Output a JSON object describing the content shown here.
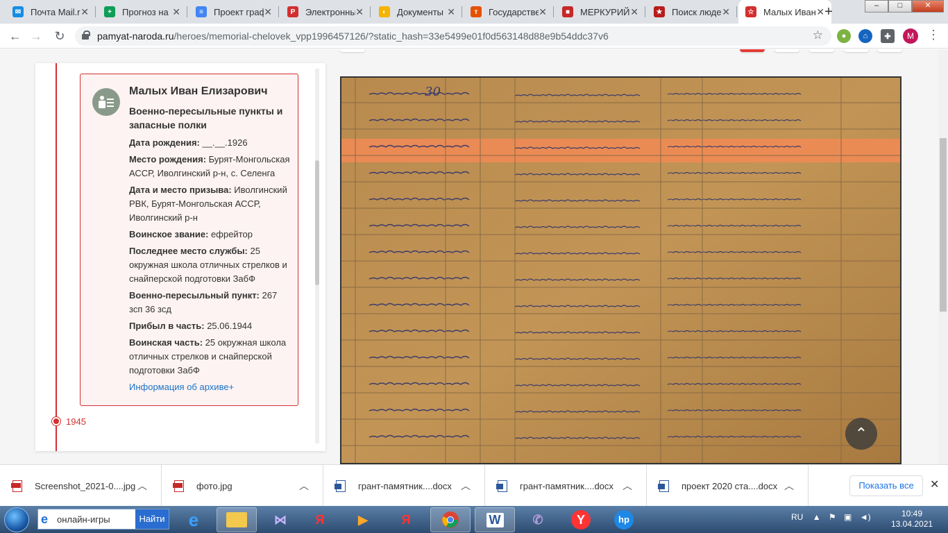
{
  "browser": {
    "tabs": [
      {
        "label": "Почта Mail.ru",
        "icon": "mail-icon",
        "color": "#168de2",
        "glyph": "✉"
      },
      {
        "label": "Прогноз на",
        "icon": "sheets-icon",
        "color": "#0f9d58",
        "glyph": "+"
      },
      {
        "label": "Проект граф",
        "icon": "docs-icon",
        "color": "#4285f4",
        "glyph": "≡"
      },
      {
        "label": "Электронны",
        "icon": "rdu-icon",
        "color": "#d32f2f",
        "glyph": "Р"
      },
      {
        "label": "Документы",
        "icon": "drive-icon",
        "color": "#f4b400",
        "glyph": "◐"
      },
      {
        "label": "Государстве",
        "icon": "gos-icon",
        "color": "#e65100",
        "glyph": "т"
      },
      {
        "label": "МЕРКУРИЙ",
        "icon": "mercury-icon",
        "color": "#c62828",
        "glyph": "■"
      },
      {
        "label": "Поиск люде",
        "icon": "search-people-icon",
        "color": "#b71c1c",
        "glyph": "★"
      },
      {
        "label": "Малых Иван",
        "icon": "memory-star-icon",
        "color": "#d32f2f",
        "glyph": "☆"
      }
    ],
    "new_tab": "+",
    "window_controls": {
      "minimize": "–",
      "maximize": "□",
      "close": "✕"
    },
    "url_host": "pamyat-naroda.ru",
    "url_path": "/heroes/memorial-chelovek_vpp1996457126/?static_hash=33e5499e01f0d563148d88e9b54ddc37v6",
    "avatar_letter": "M"
  },
  "record": {
    "name": "Малых Иван Елизарович",
    "category": "Военно-пересыльные пункты и запасные полки",
    "fields": [
      {
        "label": "Дата рождения:",
        "value": " __.__.1926"
      },
      {
        "label": "Место рождения:",
        "value": " Бурят-Монгольская АССР, Иволгинский р-н, с. Селенга"
      },
      {
        "label": "Дата и место призыва:",
        "value": " Иволгинский РВК, Бурят-Монгольская АССР, Иволгинский р-н"
      },
      {
        "label": "Воинское звание:",
        "value": " ефрейтор"
      },
      {
        "label": "Последнее место службы:",
        "value": " 25 окружная школа отличных стрелков и снайперской подготовки ЗабФ"
      },
      {
        "label": "Военно-пересыльный пункт:",
        "value": " 267 зсп 36 зсд"
      },
      {
        "label": "Прибыл в часть:",
        "value": " 25.06.1944"
      },
      {
        "label": "Воинская часть:",
        "value": " 25 окружная школа отличных стрелков и снайперской подготовки ЗабФ"
      }
    ],
    "archive_link": "Информация об архиве+",
    "year": "1945"
  },
  "document": {
    "page_number": "30"
  },
  "scroll_top_label": "⌃",
  "downloads": [
    {
      "name": "Screenshot_2021-0....jpg",
      "type": "jpg"
    },
    {
      "name": "фото.jpg",
      "type": "jpg"
    },
    {
      "name": "грант-памятник....docx",
      "type": "docx"
    },
    {
      "name": "грант-памятник....docx",
      "type": "docx"
    },
    {
      "name": "проект 2020 ста....docx",
      "type": "docx"
    }
  ],
  "show_all": "Показать все",
  "taskbar": {
    "search_placeholder": "онлайн-игры",
    "search_button": "Найти",
    "lang": "RU",
    "time": "10:49",
    "date": "13.04.2021"
  }
}
